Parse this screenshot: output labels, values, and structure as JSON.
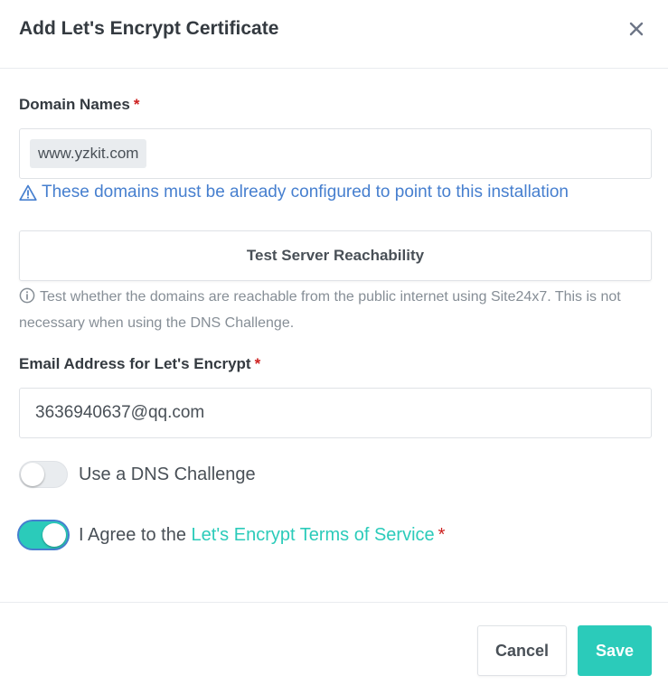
{
  "modal": {
    "title": "Add Let's Encrypt Certificate",
    "close_icon": "close-icon"
  },
  "domain_names": {
    "label": "Domain Names",
    "required_mark": "*",
    "tags": [
      "www.yzkit.com"
    ],
    "warning_icon": "warning-triangle-icon",
    "warning": "These domains must be already configured to point to this installation"
  },
  "reachability": {
    "button_label": "Test Server Reachability",
    "info_icon": "info-circle-icon",
    "help_text": "Test whether the domains are reachable from the public internet using Site24x7. This is not necessary when using the DNS Challenge."
  },
  "email": {
    "label": "Email Address for Let's Encrypt",
    "required_mark": "*",
    "value": "3636940637@qq.com"
  },
  "dns_challenge": {
    "label": "Use a DNS Challenge",
    "checked": false
  },
  "agree_terms": {
    "prefix": "I Agree to the",
    "link_text": "Let's Encrypt Terms of Service",
    "required_mark": "*",
    "checked": true
  },
  "footer": {
    "cancel_label": "Cancel",
    "save_label": "Save"
  },
  "colors": {
    "accent_teal": "#2bcbba",
    "info_blue": "#467fcf",
    "required_red": "#cd201f"
  }
}
